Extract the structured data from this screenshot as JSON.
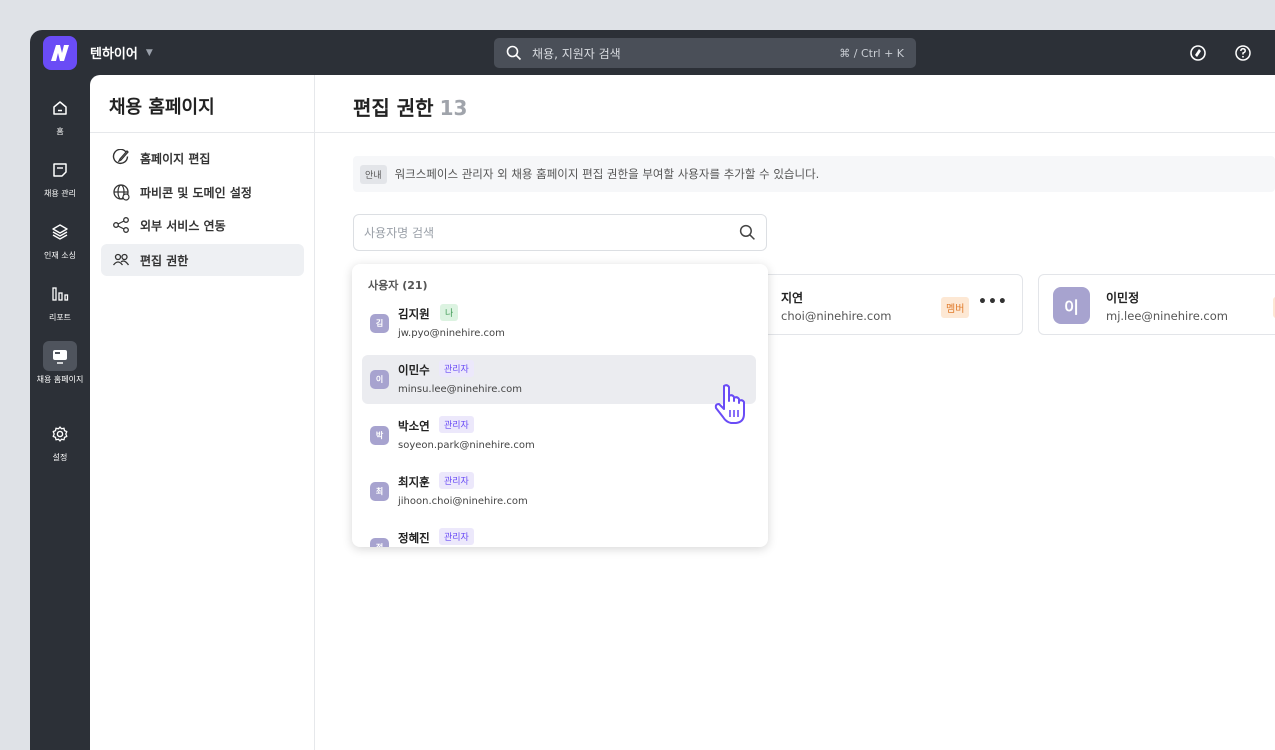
{
  "app": {
    "workspace_name": "텐하이어",
    "search_placeholder": "채용, 지원자 검색",
    "search_shortcut": "⌘ / Ctrl + K"
  },
  "rail": [
    {
      "label": "홈",
      "icon": "home-icon"
    },
    {
      "label": "채용 관리",
      "icon": "clipboard-icon"
    },
    {
      "label": "인재 소싱",
      "icon": "layers-icon"
    },
    {
      "label": "리포트",
      "icon": "bar-chart-icon"
    },
    {
      "label": "채용 홈페이지",
      "icon": "monitor-icon",
      "active": true
    },
    {
      "label": "설정",
      "icon": "gear-icon"
    }
  ],
  "subnav": {
    "title": "채용 홈페이지",
    "items": [
      {
        "label": "홈페이지 편집",
        "icon": "brush-icon"
      },
      {
        "label": "파비콘 및 도메인 설정",
        "icon": "globe-icon"
      },
      {
        "label": "외부 서비스 연동",
        "icon": "share-icon"
      },
      {
        "label": "편집 권한",
        "icon": "users-icon",
        "active": true
      }
    ]
  },
  "main": {
    "title": "편집 권한",
    "count": "13",
    "notice_tag": "안내",
    "notice_text": "워크스페이스 관리자 외 채용 홈페이지 편집 권한을 부여할 사용자를 추가할 수 있습니다.",
    "user_search_placeholder": "사용자명 검색",
    "cards": [
      {
        "name": "지연",
        "email": "choi@ninehire.com",
        "role": "멤버"
      },
      {
        "avatar": "이",
        "name": "이민정",
        "email": "mj.lee@ninehire.com",
        "role": "멤"
      }
    ]
  },
  "dropdown": {
    "header": "사용자 (21)",
    "users": [
      {
        "initial": "김",
        "name": "김지원",
        "badge": "나",
        "badge_type": "me",
        "email": "jw.pyo@ninehire.com"
      },
      {
        "initial": "이",
        "name": "이민수",
        "badge": "관리자",
        "badge_type": "admin",
        "email": "minsu.lee@ninehire.com",
        "hover": true
      },
      {
        "initial": "박",
        "name": "박소연",
        "badge": "관리자",
        "badge_type": "admin",
        "email": "soyeon.park@ninehire.com"
      },
      {
        "initial": "최",
        "name": "최지훈",
        "badge": "관리자",
        "badge_type": "admin",
        "email": "jihoon.choi@ninehire.com"
      },
      {
        "initial": "정",
        "name": "정혜진",
        "badge": "관리자",
        "badge_type": "admin",
        "email": ""
      }
    ]
  },
  "colors": {
    "accent": "#6a4cf6",
    "topbar": "#2c3037",
    "avatar": "#a7a3cf",
    "member_badge_bg": "#fde8d4",
    "member_badge_fg": "#e07a2a"
  }
}
